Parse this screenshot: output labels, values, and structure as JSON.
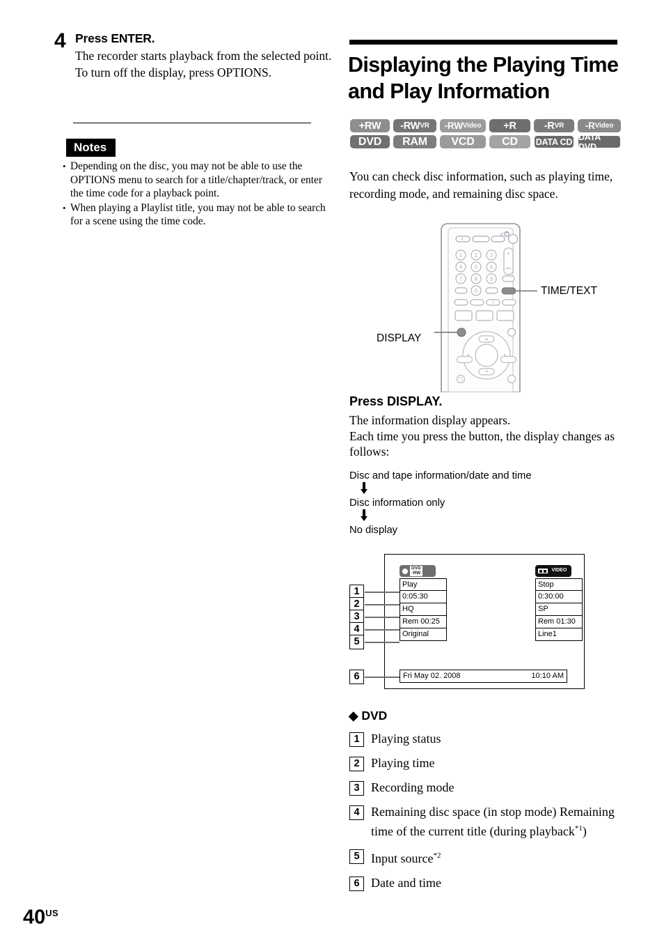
{
  "page": {
    "number": "40",
    "region_suffix": "US"
  },
  "left_column": {
    "step": {
      "number": "4",
      "title": "Press ENTER.",
      "paragraphs": [
        "The recorder starts playback from the selected point.",
        "To turn off the display, press OPTIONS."
      ]
    },
    "notes": {
      "heading": "Notes",
      "bullet": "•",
      "items": [
        "Depending on the disc, you may not be able to use the OPTIONS menu to search for a title/chapter/track, or enter the time code for a playback point.",
        "When playing a Playlist title, you may not be able to search for a scene using the time code."
      ]
    }
  },
  "right_column": {
    "section_title": "Displaying the Playing Time and Play Information",
    "disc_badges": [
      [
        {
          "main": "+RW",
          "sub": ""
        },
        {
          "main": "-RW",
          "sub": "VR"
        },
        {
          "main": "-RW",
          "sub": "Video"
        },
        {
          "main": "+R",
          "sub": ""
        },
        {
          "main": "-R",
          "sub": "VR"
        },
        {
          "main": "-R",
          "sub": "Video"
        }
      ],
      [
        {
          "main": "DVD",
          "sub": ""
        },
        {
          "main": "RAM",
          "sub": ""
        },
        {
          "main": "VCD",
          "sub": ""
        },
        {
          "main": "CD",
          "sub": ""
        },
        {
          "main": "DATA CD",
          "sub": ""
        },
        {
          "main": "DATA DVD",
          "sub": ""
        }
      ]
    ],
    "intro": "You can check disc information, such as playing time, recording mode, and remaining disc space.",
    "remote_labels": {
      "time_text": "TIME/TEXT",
      "display": "DISPLAY",
      "power_symbol": "I/⏻",
      "keys": [
        "1",
        "2",
        "3",
        "4",
        "5",
        "6",
        "7",
        "8",
        "9",
        "0"
      ],
      "volume_plus": "+",
      "volume_minus": "–"
    },
    "press_display": {
      "title": "Press DISPLAY.",
      "body": "The information display appears.\nEach time you press the button, the display changes as follows:"
    },
    "flow": {
      "steps": [
        "Disc and tape information/date and time",
        "Disc information only",
        "No display"
      ],
      "arrow": "⬇"
    },
    "osd": {
      "left_panel": {
        "icon": {
          "type": "record-dvd-rw-icon",
          "line1": "DVD",
          "line2": "-RW"
        },
        "rows": [
          "Play",
          "0:05:30",
          "HQ",
          "Rem 00:25",
          "Original"
        ]
      },
      "right_panel": {
        "icon": {
          "type": "tape-video-icon",
          "label": "VIDEO"
        },
        "rows": [
          "Stop",
          "0:30:00",
          "SP",
          "Rem 01:30",
          "Line1"
        ]
      },
      "bottom_bar": {
        "date": "Fri May 02. 2008",
        "time": "10:10 AM"
      },
      "callouts": [
        "1",
        "2",
        "3",
        "4",
        "5",
        "6"
      ]
    },
    "dvd_section": {
      "diamond": "◆",
      "heading": "DVD",
      "items": [
        {
          "num": "1",
          "text": "Playing status",
          "sup": ""
        },
        {
          "num": "2",
          "text": "Playing time",
          "sup": ""
        },
        {
          "num": "3",
          "text": "Recording mode",
          "sup": ""
        },
        {
          "num": "4",
          "text": "Remaining disc space (in stop mode) Remaining time of the current title (during playback",
          "sup": "*1",
          "tail": ")"
        },
        {
          "num": "5",
          "text": "Input source",
          "sup": "*2"
        },
        {
          "num": "6",
          "text": "Date and time",
          "sup": ""
        }
      ]
    }
  },
  "colors": {
    "badge_gray": "#8e8e8e",
    "leader_gray": "#6f6f6f",
    "remote_outline": "#9aa0a6",
    "highlight_button": "#8c8c8c"
  }
}
